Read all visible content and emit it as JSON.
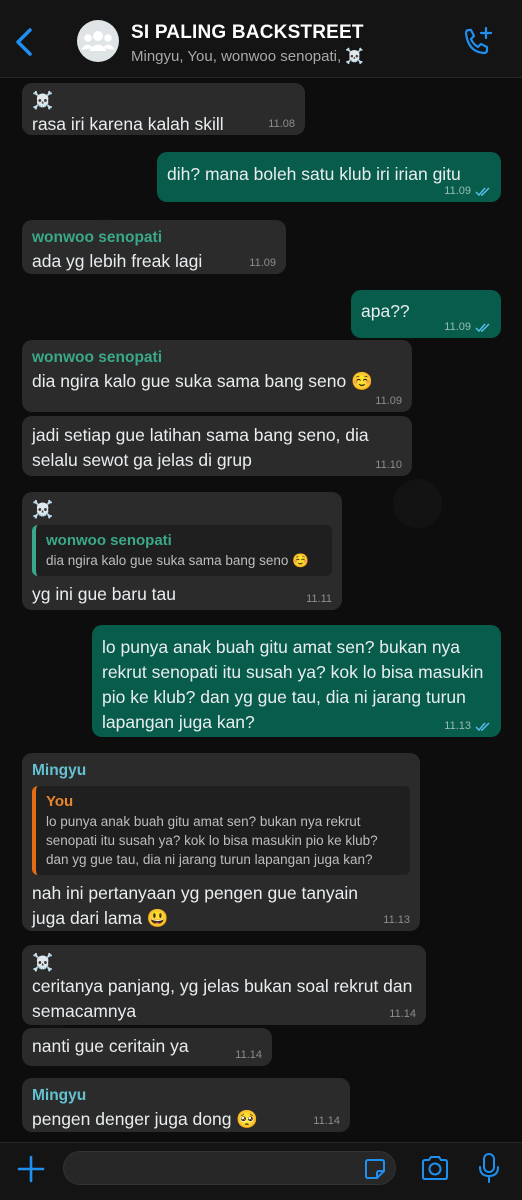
{
  "header": {
    "title": "SI PALING BACKSTREET",
    "subtitle": "Mingyu, You, wonwoo senopati, ☠️"
  },
  "messages": [
    {
      "dir": "in",
      "sender": "☠️",
      "text": "rasa iri karena kalah skill",
      "time": "11.08"
    },
    {
      "dir": "out",
      "text": "dih? mana boleh satu klub iri irian gitu",
      "time": "11.09"
    },
    {
      "dir": "in",
      "sender": "wonwoo senopati",
      "text": "ada yg lebih freak lagi",
      "time": "11.09"
    },
    {
      "dir": "out",
      "text": "apa??",
      "time": "11.09"
    },
    {
      "dir": "in",
      "sender": "wonwoo senopati",
      "text": "dia ngira kalo gue suka sama bang seno ☺️",
      "time": "11.09"
    },
    {
      "dir": "in",
      "text": "jadi setiap gue latihan sama bang seno, dia selalu sewot ga jelas di grup",
      "time": "11.10"
    },
    {
      "dir": "in",
      "sender": "☠️",
      "quote_author": "wonwoo senopati",
      "quote_text": "dia ngira kalo gue suka sama bang seno ☺️",
      "text": "yg ini gue baru tau",
      "time": "11.11"
    },
    {
      "dir": "out",
      "text": "lo punya anak buah gitu amat sen? bukan nya rekrut senopati itu susah ya? kok lo bisa masukin pio ke klub? dan yg gue tau, dia ni jarang turun lapangan juga kan?",
      "time": "11.13"
    },
    {
      "dir": "in",
      "sender": "Mingyu",
      "quote_author": "You",
      "quote_text": "lo punya anak buah gitu amat sen? bukan nya rekrut senopati itu susah ya? kok lo bisa masukin pio ke klub? dan yg gue tau, dia ni jarang turun lapangan juga kan?",
      "text": "nah ini pertanyaan yg pengen gue tanyain juga dari lama 😃",
      "time": "11.13"
    },
    {
      "dir": "in",
      "sender": "☠️",
      "text": "ceritanya panjang, yg jelas bukan soal rekrut dan semacamnya",
      "time": "11.14"
    },
    {
      "dir": "in",
      "text": "nanti gue ceritain ya",
      "time": "11.14"
    },
    {
      "dir": "in",
      "sender": "Mingyu",
      "text": "pengen denger juga dong 🥺",
      "time": "11.14"
    }
  ],
  "composer": {
    "placeholder": "",
    "value": ""
  },
  "colors": {
    "outgoing_bubble": "#075c4b",
    "incoming_bubble": "#2b2b2b",
    "accent_blue": "#1f8ff0",
    "sender_green": "#3aa88a",
    "sender_teal": "#63c1d1",
    "quote_orange": "#e26d16"
  },
  "icons": [
    "back-chevron-icon",
    "group-avatar-icon",
    "add-call-icon",
    "plus-icon",
    "sticker-icon",
    "camera-icon",
    "microphone-icon"
  ]
}
